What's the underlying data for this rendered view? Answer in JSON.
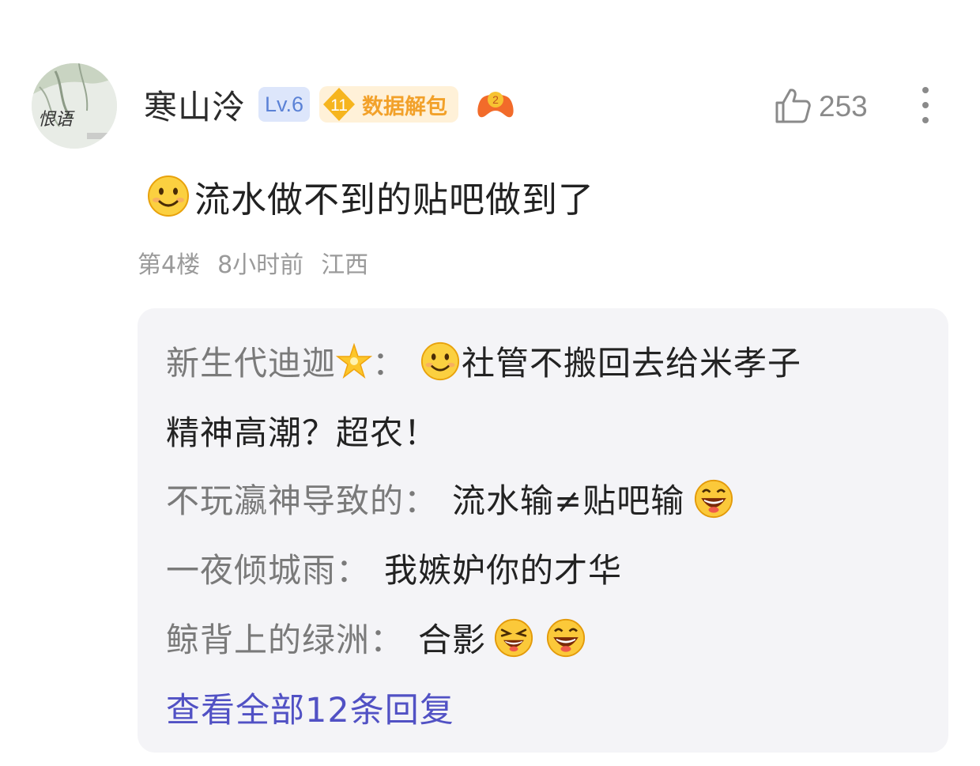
{
  "post": {
    "author": {
      "username": "寒山泠",
      "level_badge": "Lv.6",
      "fan_level": "11",
      "fan_badge": "数据解包",
      "avatar_text": "恨语"
    },
    "likes": "253",
    "content": "流水做不到的贴吧做到了",
    "meta": {
      "floor": "第4楼",
      "time": "8小时前",
      "location": "江西"
    }
  },
  "replies": [
    {
      "name": "新生代迪迦",
      "sep": "：",
      "text_line1": "社管不搬回去给米孝子",
      "text_line2": "精神高潮？超农！"
    },
    {
      "name": "不玩瀛神导致的",
      "sep": "：",
      "text": "流水输≠贴吧输"
    },
    {
      "name": "一夜倾城雨",
      "sep": "：",
      "text": "我嫉妒你的才华"
    },
    {
      "name": "鲸背上的绿洲",
      "sep": "：",
      "text": "合影"
    }
  ],
  "view_all": "查看全部12条回复",
  "colors": {
    "accent": "#5151c4",
    "level_badge_bg": "#dde6fb",
    "fan_badge_orange": "#f2a12a",
    "reply_bg": "#f4f4f7"
  },
  "icons": [
    "thumbs-up-icon",
    "more-vertical-icon",
    "smile-emoji",
    "star-emoji",
    "grin-emoji",
    "laugh-emoji",
    "game-controller-icon"
  ]
}
